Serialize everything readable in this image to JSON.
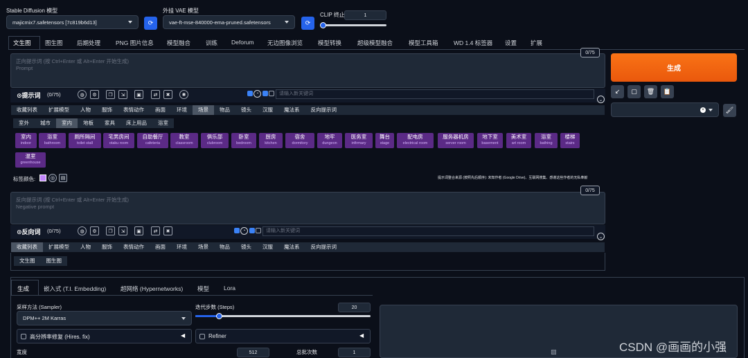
{
  "top": {
    "model_label": "Stable Diffusion 模型",
    "model_value": "majicmix7.safetensors [7c819b6d13]",
    "vae_label": "外挂 VAE 模型",
    "vae_value": "vae-ft-mse-840000-ema-pruned.safetensors",
    "clip_label": "CLIP 终止层数",
    "clip_value": "1"
  },
  "tabs": [
    "文生图",
    "图生图",
    "后期处理",
    "PNG 图片信息",
    "模型融合",
    "训练",
    "Deforum",
    "无边图像浏览",
    "模型转换",
    "超级模型融合",
    "模型工具箱",
    "WD 1.4 标签器",
    "设置",
    "扩展"
  ],
  "prompt": {
    "placeholder": "正向提示词 (按 Ctrl+Enter 或 Alt+Enter 开始生成)",
    "placeholder_en": "Prompt",
    "counter": "0/75",
    "title": "提示词",
    "count": "(0/75)",
    "kw_placeholder": "请输入新关键词"
  },
  "categories": [
    "收藏列表",
    "扩展模型",
    "人物",
    "服饰",
    "表情动作",
    "画面",
    "环境",
    "场景",
    "物品",
    "镜头",
    "汉服",
    "魔法系",
    "反向提示词"
  ],
  "subcategories": [
    "室外",
    "城市",
    "室内",
    "地板",
    "家具",
    "床上用品",
    "浴室"
  ],
  "tags": [
    {
      "zh": "室内",
      "en": "indoor"
    },
    {
      "zh": "浴室",
      "en": "bathroom"
    },
    {
      "zh": "厕所隔间",
      "en": "toilet stall"
    },
    {
      "zh": "宅男房间",
      "en": "otaku room"
    },
    {
      "zh": "自助餐厅",
      "en": "cafeteria"
    },
    {
      "zh": "教室",
      "en": "classroom"
    },
    {
      "zh": "俱乐部",
      "en": "clubroom"
    },
    {
      "zh": "卧室",
      "en": "bedroom"
    },
    {
      "zh": "厨房",
      "en": "kitchen"
    },
    {
      "zh": "宿舍",
      "en": "dormitory"
    },
    {
      "zh": "地牢",
      "en": "dungeon"
    },
    {
      "zh": "医务室",
      "en": "infirmary"
    },
    {
      "zh": "舞台",
      "en": "stage"
    },
    {
      "zh": "配电房",
      "en": "electrical room"
    },
    {
      "zh": "服务器机房",
      "en": "server room"
    },
    {
      "zh": "地下室",
      "en": "basement"
    },
    {
      "zh": "美术室",
      "en": "art room"
    },
    {
      "zh": "浴室",
      "en": "bathing"
    },
    {
      "zh": "楼梯",
      "en": "stairs"
    },
    {
      "zh": "温室",
      "en": "greenhouse"
    }
  ],
  "tag_color_label": "标签颜色:",
  "note": "提示词整合来源 (按照先后顺序): 未知作者 (Google Drive)、互联网搜集、感谢这些作者的无私奉献",
  "neg": {
    "placeholder": "反向提示词 (按 Ctrl+Enter 或 Alt+Enter 开始生成)",
    "placeholder_en": "Negative prompt",
    "counter": "0/75",
    "title": "反向词",
    "count": "(0/75)",
    "kw_placeholder": "请输入新关键词"
  },
  "neg_categories": [
    "收藏列表",
    "扩展模型",
    "人物",
    "服饰",
    "表情动作",
    "画面",
    "环境",
    "场景",
    "物品",
    "镜头",
    "汉服",
    "魔法系",
    "反向提示词"
  ],
  "neg_sub": [
    "文生图",
    "图生图"
  ],
  "gen_tabs": [
    "生成",
    "嵌入式 (T.I. Embedding)",
    "超网络 (Hypernetworks)",
    "模型",
    "Lora"
  ],
  "sampler": {
    "label": "采样方法 (Sampler)",
    "value": "DPM++ 2M Karras"
  },
  "steps": {
    "label": "迭代步数 (Steps)",
    "value": "20",
    "fraction": 0.133
  },
  "hires": "高分辨率修复 (Hires. fix)",
  "refiner": "Refiner",
  "width": {
    "label": "宽度",
    "value": "512"
  },
  "batch": {
    "label": "总批次数",
    "value": "1"
  },
  "generate": "生成",
  "watermark": "CSDN @画画的小强",
  "colors": {
    "accent": "#f97316",
    "tag": "#5b2a86",
    "blue": "#2563eb"
  }
}
